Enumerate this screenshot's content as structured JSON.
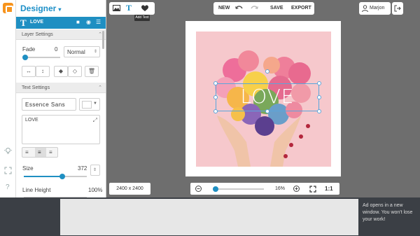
{
  "app": {
    "title": "Designer"
  },
  "layer": {
    "name": "LOVE"
  },
  "layer_settings": {
    "header": "Layer Settings",
    "fade_label": "Fade",
    "fade_value": "0",
    "blend_mode": "Normal"
  },
  "text_settings": {
    "header": "Text Settings",
    "font": "Essence Sans",
    "text_value": "LOVE",
    "size_label": "Size",
    "size_value": "372",
    "line_height_label": "Line Height",
    "line_height_value": "100%"
  },
  "toolbar": {
    "new_label": "NEW",
    "save_label": "SAVE",
    "export_label": "EXPORT",
    "tooltip": "Add Text",
    "user_name": "Marjon"
  },
  "canvas": {
    "text": "LOVE",
    "dimensions": "2400 x 2400",
    "zoom": "16%",
    "actual_size_label": "1:1"
  },
  "ad": {
    "notice": "Ad opens in a new window. You won't lose your work!"
  },
  "colors": {
    "accent": "#1f8fc2",
    "brand": "#f7941d",
    "photo_bg": "#f6c8cc"
  }
}
